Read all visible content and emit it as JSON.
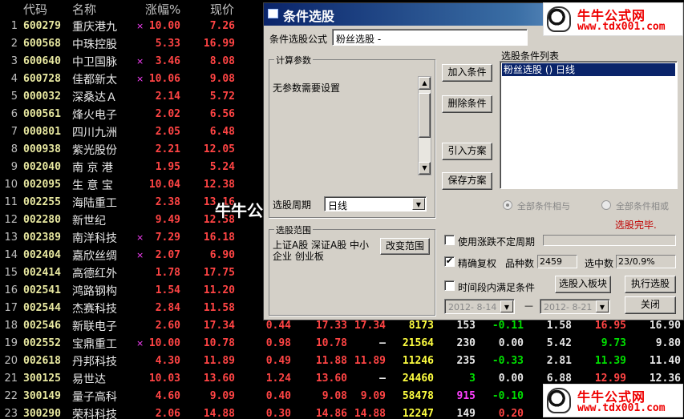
{
  "table": {
    "headers": {
      "code": "代码",
      "name": "名称",
      "pct": "涨幅%",
      "price": "现价"
    },
    "rows": [
      {
        "idx": "1",
        "code": "600279",
        "name": "重庆港九",
        "mark": "×",
        "pct": "10.00",
        "price": "7.26"
      },
      {
        "idx": "2",
        "code": "600568",
        "name": "中珠控股",
        "mark": "",
        "pct": "5.33",
        "price": "16.99"
      },
      {
        "idx": "3",
        "code": "600640",
        "name": "中卫国脉",
        "mark": "×",
        "pct": "3.46",
        "price": "8.08"
      },
      {
        "idx": "4",
        "code": "600728",
        "name": "佳都新太",
        "mark": "×",
        "pct": "10.06",
        "price": "9.08"
      },
      {
        "idx": "5",
        "code": "000032",
        "name": "深桑达Ａ",
        "mark": "",
        "pct": "2.14",
        "price": "5.72"
      },
      {
        "idx": "6",
        "code": "000561",
        "name": "烽火电子",
        "mark": "",
        "pct": "2.02",
        "price": "6.56"
      },
      {
        "idx": "7",
        "code": "000801",
        "name": "四川九洲",
        "mark": "",
        "pct": "2.05",
        "price": "6.48"
      },
      {
        "idx": "8",
        "code": "000938",
        "name": "紫光股份",
        "mark": "",
        "pct": "2.21",
        "price": "12.05"
      },
      {
        "idx": "9",
        "code": "002040",
        "name": "南 京 港",
        "mark": "",
        "pct": "1.95",
        "price": "5.24"
      },
      {
        "idx": "10",
        "code": "002095",
        "name": "生 意 宝",
        "mark": "",
        "pct": "10.04",
        "price": "12.38"
      },
      {
        "idx": "11",
        "code": "002255",
        "name": "海陆重工",
        "mark": "",
        "pct": "2.38",
        "price": "13.16"
      },
      {
        "idx": "12",
        "code": "002280",
        "name": "新世纪",
        "mark": "",
        "pct": "9.49",
        "price": "12.58"
      },
      {
        "idx": "13",
        "code": "002389",
        "name": "南洋科技",
        "mark": "×",
        "pct": "7.29",
        "price": "16.18"
      },
      {
        "idx": "14",
        "code": "002404",
        "name": "嘉欣丝绸",
        "mark": "×",
        "pct": "2.07",
        "price": "6.90"
      },
      {
        "idx": "15",
        "code": "002414",
        "name": "高德红外",
        "mark": "",
        "pct": "1.78",
        "price": "17.75"
      },
      {
        "idx": "16",
        "code": "002541",
        "name": "鸿路钢构",
        "mark": "",
        "pct": "1.54",
        "price": "11.20"
      },
      {
        "idx": "17",
        "code": "002544",
        "name": "杰赛科技",
        "mark": "",
        "pct": "2.84",
        "price": "11.58"
      },
      {
        "idx": "18",
        "code": "002546",
        "name": "新联电子",
        "mark": "",
        "pct": "2.60",
        "price": "17.34",
        "ext": [
          "0.44",
          "17.33",
          "17.34",
          "8173",
          "153",
          "-0.11",
          "1.58",
          "16.95",
          "16.90"
        ]
      },
      {
        "idx": "19",
        "code": "002552",
        "name": "宝鼎重工",
        "mark": "×",
        "pct": "10.00",
        "price": "10.78",
        "ext": [
          "0.98",
          "10.78",
          "—",
          "21564",
          "230",
          "0.00",
          "5.42",
          "9.73",
          "9.80"
        ]
      },
      {
        "idx": "20",
        "code": "002618",
        "name": "丹邦科技",
        "mark": "",
        "pct": "4.30",
        "price": "11.89",
        "ext": [
          "0.49",
          "11.88",
          "11.89",
          "11246",
          "235",
          "-0.33",
          "2.81",
          "11.39",
          "11.40"
        ]
      },
      {
        "idx": "21",
        "code": "300125",
        "name": "易世达",
        "mark": "",
        "pct": "10.03",
        "price": "13.60",
        "ext": [
          "1.24",
          "13.60",
          "—",
          "24460",
          "3",
          "0.00",
          "6.88",
          "12.99",
          "12.36"
        ]
      },
      {
        "idx": "22",
        "code": "300149",
        "name": "量子高科",
        "mark": "",
        "pct": "4.60",
        "price": "9.09",
        "ext": [
          "0.40",
          "9.08",
          "9.09",
          "58478",
          "915",
          "-0.10",
          "",
          "",
          ""
        ]
      },
      {
        "idx": "23",
        "code": "300290",
        "name": "荣科科技",
        "mark": "",
        "pct": "2.06",
        "price": "14.88",
        "ext": [
          "0.30",
          "14.86",
          "14.88",
          "12247",
          "149",
          "0.20",
          "",
          "",
          ""
        ]
      }
    ]
  },
  "dialog": {
    "title": "条件选股",
    "formula_label": "条件选股公式",
    "formula_value": "粉丝选股 -",
    "calc_group": "计算参数",
    "calc_text": "无参数需要设置",
    "period_label": "选股周期",
    "period_value": "日线",
    "range_group": "选股范围",
    "range_text": "上证A股 深证A股 中小企业 创业板",
    "change_range_btn": "改变范围",
    "add_btn": "加入条件",
    "del_btn": "删除条件",
    "import_btn": "引入方案",
    "save_btn": "保存方案",
    "list_label": "选股条件列表",
    "list_item": "粉丝选股  ()  日线",
    "radio_and": "全部条件相与",
    "radio_or": "全部条件相或",
    "status": "选股完毕.",
    "use_period_label": "使用涨跌不定周期",
    "exact_label": "精确复权",
    "count_label": "品种数",
    "count_value": "2459",
    "hit_label": "选中数",
    "hit_value": "23/0.9%",
    "time_label": "时间段内满足条件",
    "date_from": "2012- 8-14",
    "date_to": "2012- 8-21",
    "dash": "—",
    "to_board_btn": "选股入板块",
    "run_btn": "执行选股",
    "close_btn": "关闭"
  },
  "watermark": {
    "center": "牛牛公式网 www.tdx001.com",
    "logo_title": "牛牛公式网",
    "logo_url": "www.tdx001.com"
  },
  "colors": {
    "up": "#ff4444",
    "down": "#00e000",
    "volume": "#ffff40",
    "title_bar": "#0a246a"
  }
}
